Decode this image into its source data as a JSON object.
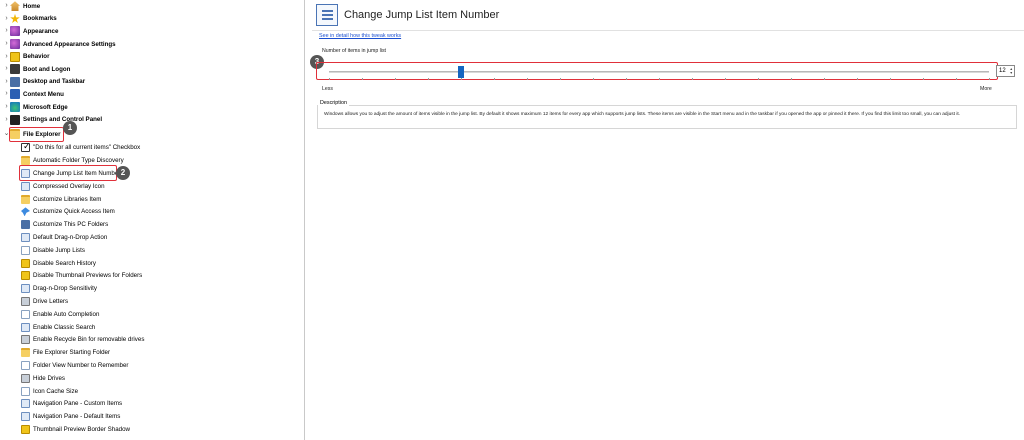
{
  "tree": {
    "top_items": [
      {
        "label": "Home",
        "icon": "home-icon"
      },
      {
        "label": "Bookmarks",
        "icon": "star-icon"
      },
      {
        "label": "Appearance",
        "icon": "appearance-icon"
      },
      {
        "label": "Advanced Appearance Settings",
        "icon": "advanced-appearance-icon"
      },
      {
        "label": "Behavior",
        "icon": "behavior-icon"
      },
      {
        "label": "Boot and Logon",
        "icon": "boot-icon"
      },
      {
        "label": "Desktop and Taskbar",
        "icon": "desktop-icon"
      },
      {
        "label": "Context Menu",
        "icon": "context-menu-icon"
      },
      {
        "label": "Microsoft Edge",
        "icon": "edge-icon"
      },
      {
        "label": "Settings and Control Panel",
        "icon": "gear-icon"
      },
      {
        "label": "File Explorer",
        "icon": "folder-icon"
      }
    ],
    "children": [
      {
        "label": "\"Do this for all current items\" Checkbox",
        "icon": "checkbox-icon"
      },
      {
        "label": "Automatic Folder Type Discovery",
        "icon": "folder-icon"
      },
      {
        "label": "Change Jump List Item Number",
        "icon": "list-icon"
      },
      {
        "label": "Compressed Overlay Icon",
        "icon": "overlay-icon"
      },
      {
        "label": "Customize Libraries Item",
        "icon": "library-icon"
      },
      {
        "label": "Customize Quick Access Item",
        "icon": "pin-icon"
      },
      {
        "label": "Customize This PC Folders",
        "icon": "pc-icon"
      },
      {
        "label": "Default Drag-n-Drop Action",
        "icon": "drag-icon"
      },
      {
        "label": "Disable Jump Lists",
        "icon": "list-icon"
      },
      {
        "label": "Disable Search History",
        "icon": "search-icon"
      },
      {
        "label": "Disable Thumbnail Previews for Folders",
        "icon": "thumbnail-icon"
      },
      {
        "label": "Drag-n-Drop Sensitivity",
        "icon": "drag-icon"
      },
      {
        "label": "Drive Letters",
        "icon": "drive-icon"
      },
      {
        "label": "Enable Auto Completion",
        "icon": "doc-icon"
      },
      {
        "label": "Enable Classic Search",
        "icon": "search-icon"
      },
      {
        "label": "Enable Recycle Bin for removable drives",
        "icon": "recycle-icon"
      },
      {
        "label": "File Explorer Starting Folder",
        "icon": "folder-icon"
      },
      {
        "label": "Folder View Number to Remember",
        "icon": "doc-icon"
      },
      {
        "label": "Hide Drives",
        "icon": "drive-icon"
      },
      {
        "label": "Icon Cache Size",
        "icon": "doc-icon"
      },
      {
        "label": "Navigation Pane - Custom Items",
        "icon": "nav-pane-icon"
      },
      {
        "label": "Navigation Pane - Default Items",
        "icon": "nav-pane-icon"
      },
      {
        "label": "Thumbnail Preview Border Shadow",
        "icon": "thumbnail-icon"
      }
    ]
  },
  "badges": {
    "one": "1",
    "two": "2",
    "three": "3"
  },
  "detail": {
    "title": "Change Jump List Item Number",
    "link": "See in detail how this tweak works",
    "slider_label": "Number of items in jump list",
    "slider_value": 12,
    "slider_min": 0,
    "slider_max": 60,
    "slider_value_text": "12",
    "less_label": "Less",
    "more_label": "More",
    "description_title": "Description",
    "description_text": "Windows allows you to adjust the amount of items visible in the jump list. By default it shows maximum 12 items for every app which supports jump lists. These items are visible in the Start menu and in the taskbar if you opened the app or pinned it there. If you find this limit too small, you can adjust it."
  },
  "colors": {
    "accent": "#1565c0",
    "highlight": "#e0303a",
    "badge": "#555555",
    "link": "#1a4fd0"
  }
}
